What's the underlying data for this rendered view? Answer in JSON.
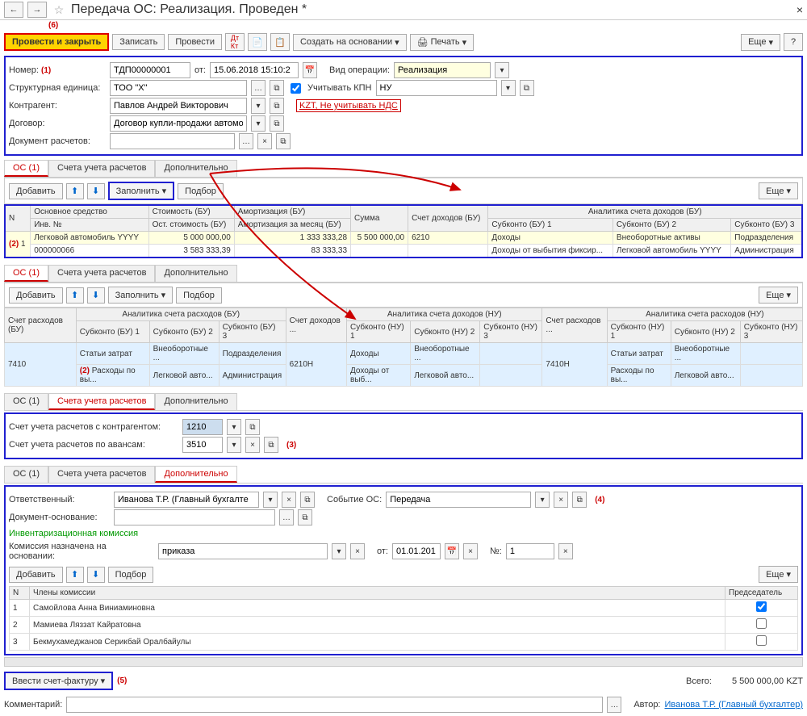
{
  "title": "Передача ОС: Реализация. Проведен *",
  "ann": {
    "a1": "(1)",
    "a2": "(2)",
    "a3": "(3)",
    "a4": "(4)",
    "a5": "(5)",
    "a6": "(6)"
  },
  "toolbar": {
    "post_close": "Провести и закрыть",
    "save": "Записать",
    "post": "Провести",
    "create_based": "Создать на основании",
    "print": "Печать",
    "more": "Еще"
  },
  "form": {
    "number_lbl": "Номер:",
    "number": "ТДП00000001",
    "date_lbl": "от:",
    "date": "15.06.2018 15:10:2",
    "op_type_lbl": "Вид операции:",
    "op_type": "Реализация",
    "struct_lbl": "Структурная единица:",
    "struct": "ТОО \"X\"",
    "kpn_lbl": "Учитывать КПН",
    "nu": "НУ",
    "counterparty_lbl": "Контрагент:",
    "counterparty": "Павлов Андрей Викторович",
    "kzt": "KZT, Не учитывать НДС",
    "contract_lbl": "Договор:",
    "contract": "Договор купли-продажи автомобил",
    "doc_calc_lbl": "Документ расчетов:"
  },
  "tabs": {
    "os": "ОС (1)",
    "accounts": "Счета учета расчетов",
    "extra": "Дополнительно"
  },
  "tab_toolbar": {
    "add": "Добавить",
    "fill": "Заполнить",
    "pick": "Подбор"
  },
  "table1": {
    "h": {
      "n": "N",
      "asset": "Основное средство",
      "inv": "Инв. №",
      "cost": "Стоимость (БУ)",
      "rest": "Ост. стоимость (БУ)",
      "amort": "Амортизация (БУ)",
      "amort_m": "Амортизация за месяц (БУ)",
      "sum": "Сумма",
      "inc_acc": "Счет доходов (БУ)",
      "anal": "Аналитика счета доходов (БУ)",
      "sk1": "Субконто (БУ) 1",
      "sk2": "Субконто (БУ) 2",
      "sk3": "Субконто (БУ) 3"
    },
    "r": {
      "n": "1",
      "asset": "Легковой автомобиль YYYY",
      "inv": "000000066",
      "cost": "5 000 000,00",
      "rest": "3 583 333,39",
      "amort": "1 333 333,28",
      "amort_m": "83 333,33",
      "sum": "5 500 000,00",
      "inc_acc": "6210",
      "sk1a": "Доходы",
      "sk1b": "Доходы от выбытия фиксир...",
      "sk2a": "Внеоборотные активы",
      "sk2b": "Легковой автомобиль YYYY",
      "sk3a": "Подразделения",
      "sk3b": "Администрация"
    }
  },
  "table2": {
    "h": {
      "exp_acc": "Счет расходов (БУ)",
      "anal_exp": "Аналитика счета расходов (БУ)",
      "sk1": "Субконто (БУ) 1",
      "sk2": "Субконто (БУ) 2",
      "sk3": "Субконто (БУ) 3",
      "inc_acc_n": "Счет доходов ...",
      "anal_inc_n": "Аналитика счета доходов (НУ)",
      "skn1": "Субконто (НУ) 1",
      "skn2": "Субконто (НУ) 2",
      "skn3": "Субконто (НУ) 3",
      "exp_acc_n": "Счет расходов ...",
      "anal_exp_n": "Аналитика счета расходов (НУ)",
      "sken1": "Субконто (НУ) 1",
      "sken2": "Субконто (НУ) 2",
      "sken3": "Субконто (НУ) 3"
    },
    "r": {
      "exp_acc": "7410",
      "sk1a": "Статьи затрат",
      "sk1b": "Расходы по вы...",
      "sk2a": "Внеоборотные ...",
      "sk2b": "Легковой авто...",
      "sk3a": "Подразделения",
      "sk3b": "Администрация",
      "inc_acc_n": "6210Н",
      "skn1a": "Доходы",
      "skn1b": "Доходы от выб...",
      "skn2a": "Внеоборотные ...",
      "skn2b": "Легковой авто...",
      "exp_acc_n": "7410Н",
      "sken1a": "Статьи затрат",
      "sken1b": "Расходы по вы...",
      "sken2a": "Внеоборотные ...",
      "sken2b": "Легковой авто..."
    }
  },
  "accounts": {
    "contr_lbl": "Счет учета расчетов с контрагентом:",
    "contr": "1210",
    "adv_lbl": "Счет учета расчетов по авансам:",
    "adv": "3510"
  },
  "extra": {
    "resp_lbl": "Ответственный:",
    "resp": "Иванова Т.Р. (Главный бухгалте",
    "event_lbl": "Событие ОС:",
    "event": "Передача",
    "doc_base_lbl": "Документ-основание:",
    "committee_title": "Инвентаризационная комиссия",
    "comm_base_lbl": "Комиссия назначена на основании:",
    "comm_base": "приказа",
    "from_lbl": "от:",
    "from_date": "01.01.201",
    "n_lbl": "№:",
    "n": "1",
    "h_n": "N",
    "h_member": "Члены комиссии",
    "h_chair": "Председатель",
    "m1n": "1",
    "m1": "Самойлова Анна Виниаминовна",
    "m2n": "2",
    "m2": "Мамиева Ляззат Кайратовна",
    "m3n": "3",
    "m3": "Бекмухамеджанов Серикбай Оралбайулы"
  },
  "footer": {
    "invoice": "Ввести счет-фактуру",
    "total_lbl": "Всего:",
    "total": "5 500 000,00  KZT",
    "comment_lbl": "Комментарий:",
    "author_lbl": "Автор:",
    "author": "Иванова Т.Р. (Главный бухгалтер)"
  }
}
